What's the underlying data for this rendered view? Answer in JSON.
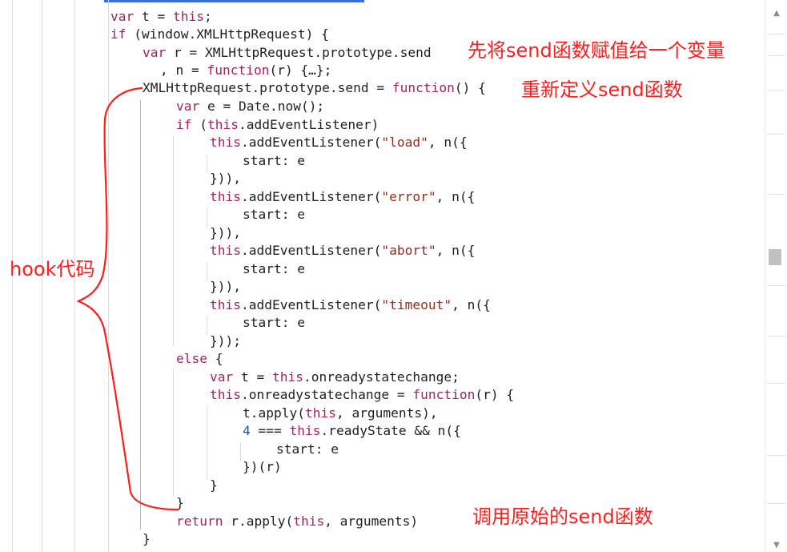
{
  "code": {
    "lines": [
      [
        {
          "t": "var",
          "c": "kw"
        },
        {
          "t": " t = ",
          "c": "pl"
        },
        {
          "t": "this",
          "c": "kw"
        },
        {
          "t": ";",
          "c": "pl"
        }
      ],
      [
        {
          "t": "if",
          "c": "kw"
        },
        {
          "t": " (window.XMLHttpRequest) {",
          "c": "pl"
        }
      ],
      [
        {
          "t": "var",
          "c": "kw"
        },
        {
          "t": " r = XMLHttpRequest.prototype.send",
          "c": "pl"
        }
      ],
      [
        {
          "t": ", n = ",
          "c": "pl"
        },
        {
          "t": "function",
          "c": "kw"
        },
        {
          "t": "(r) {…};",
          "c": "pl"
        }
      ],
      [
        {
          "t": "XMLHttpRequest.prototype.send = ",
          "c": "pl"
        },
        {
          "t": "function",
          "c": "kw"
        },
        {
          "t": "() {",
          "c": "pl"
        }
      ],
      [
        {
          "t": "var",
          "c": "kw"
        },
        {
          "t": " e = Date.now();",
          "c": "pl"
        }
      ],
      [
        {
          "t": "if",
          "c": "kw"
        },
        {
          "t": " (",
          "c": "pl"
        },
        {
          "t": "this",
          "c": "kw"
        },
        {
          "t": ".addEventListener)",
          "c": "pl"
        }
      ],
      [
        {
          "t": "this",
          "c": "kw"
        },
        {
          "t": ".addEventListener(",
          "c": "pl"
        },
        {
          "t": "\"load\"",
          "c": "str"
        },
        {
          "t": ", n({",
          "c": "pl"
        }
      ],
      [
        {
          "t": "start: e",
          "c": "pl"
        }
      ],
      [
        {
          "t": "})),",
          "c": "pl"
        }
      ],
      [
        {
          "t": "this",
          "c": "kw"
        },
        {
          "t": ".addEventListener(",
          "c": "pl"
        },
        {
          "t": "\"error\"",
          "c": "str"
        },
        {
          "t": ", n({",
          "c": "pl"
        }
      ],
      [
        {
          "t": "start: e",
          "c": "pl"
        }
      ],
      [
        {
          "t": "})),",
          "c": "pl"
        }
      ],
      [
        {
          "t": "this",
          "c": "kw"
        },
        {
          "t": ".addEventListener(",
          "c": "pl"
        },
        {
          "t": "\"abort\"",
          "c": "str"
        },
        {
          "t": ", n({",
          "c": "pl"
        }
      ],
      [
        {
          "t": "start: e",
          "c": "pl"
        }
      ],
      [
        {
          "t": "})),",
          "c": "pl"
        }
      ],
      [
        {
          "t": "this",
          "c": "kw"
        },
        {
          "t": ".addEventListener(",
          "c": "pl"
        },
        {
          "t": "\"timeout\"",
          "c": "str"
        },
        {
          "t": ", n({",
          "c": "pl"
        }
      ],
      [
        {
          "t": "start: e",
          "c": "pl"
        }
      ],
      [
        {
          "t": "}));",
          "c": "pl"
        }
      ],
      [
        {
          "t": "else",
          "c": "kw"
        },
        {
          "t": " {",
          "c": "pl"
        }
      ],
      [
        {
          "t": "var",
          "c": "kw"
        },
        {
          "t": " t = ",
          "c": "pl"
        },
        {
          "t": "this",
          "c": "kw"
        },
        {
          "t": ".onreadystatechange;",
          "c": "pl"
        }
      ],
      [
        {
          "t": "this",
          "c": "kw"
        },
        {
          "t": ".onreadystatechange = ",
          "c": "pl"
        },
        {
          "t": "function",
          "c": "kw"
        },
        {
          "t": "(r) {",
          "c": "pl"
        }
      ],
      [
        {
          "t": "t.apply(",
          "c": "pl"
        },
        {
          "t": "this",
          "c": "kw"
        },
        {
          "t": ", arguments),",
          "c": "pl"
        }
      ],
      [
        {
          "t": "4",
          "c": "num"
        },
        {
          "t": " === ",
          "c": "pl"
        },
        {
          "t": "this",
          "c": "kw"
        },
        {
          "t": ".readyState && n({",
          "c": "pl"
        }
      ],
      [
        {
          "t": "start: e",
          "c": "pl"
        }
      ],
      [
        {
          "t": "})(r)",
          "c": "pl"
        }
      ],
      [
        {
          "t": "}",
          "c": "pl"
        }
      ],
      [
        {
          "t": "}",
          "c": "pl"
        }
      ],
      [
        {
          "t": "return",
          "c": "kw"
        },
        {
          "t": " r.apply(",
          "c": "pl"
        },
        {
          "t": "this",
          "c": "kw"
        },
        {
          "t": ", arguments)",
          "c": "pl"
        }
      ],
      [
        {
          "t": "}",
          "c": "pl"
        }
      ]
    ]
  },
  "annotations": {
    "assign_send": "先将send函数赋值给一个变量",
    "redefine_send": "重新定义send函数",
    "hook_code": "hook代码",
    "call_original": "调用原始的send函数"
  },
  "colors": {
    "keyword": "#a4235f",
    "string": "#992a1a",
    "number": "#1a4fc9",
    "annotation": "#ff1e1e"
  },
  "icons": {
    "scroll_up": "triangle-up",
    "scroll_down": "triangle-down"
  }
}
